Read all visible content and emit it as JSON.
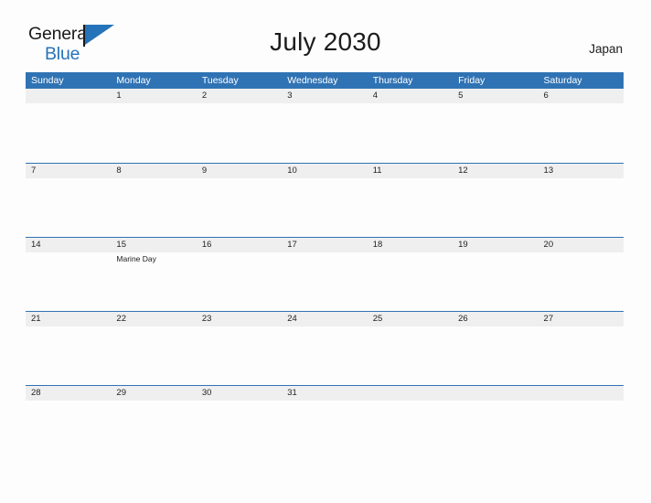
{
  "brand": {
    "line1": "General",
    "line2": "Blue",
    "flag_icon": "blue-triangle-flag-icon",
    "accent_color": "#2573b8"
  },
  "header": {
    "title": "July 2030",
    "locale": "Japan"
  },
  "calendar": {
    "month": "July",
    "year": "2030",
    "header_bg_color": "#3073b4",
    "band_bg_color": "#efefef",
    "weekdays": [
      {
        "label": "Sunday"
      },
      {
        "label": "Monday"
      },
      {
        "label": "Tuesday"
      },
      {
        "label": "Wednesday"
      },
      {
        "label": "Thursday"
      },
      {
        "label": "Friday"
      },
      {
        "label": "Saturday"
      }
    ],
    "weeks": [
      [
        {
          "day": ""
        },
        {
          "day": "1"
        },
        {
          "day": "2"
        },
        {
          "day": "3"
        },
        {
          "day": "4"
        },
        {
          "day": "5"
        },
        {
          "day": "6"
        }
      ],
      [
        {
          "day": "7"
        },
        {
          "day": "8"
        },
        {
          "day": "9"
        },
        {
          "day": "10"
        },
        {
          "day": "11"
        },
        {
          "day": "12"
        },
        {
          "day": "13"
        }
      ],
      [
        {
          "day": "14"
        },
        {
          "day": "15",
          "event": "Marine Day"
        },
        {
          "day": "16"
        },
        {
          "day": "17"
        },
        {
          "day": "18"
        },
        {
          "day": "19"
        },
        {
          "day": "20"
        }
      ],
      [
        {
          "day": "21"
        },
        {
          "day": "22"
        },
        {
          "day": "23"
        },
        {
          "day": "24"
        },
        {
          "day": "25"
        },
        {
          "day": "26"
        },
        {
          "day": "27"
        }
      ],
      [
        {
          "day": "28"
        },
        {
          "day": "29"
        },
        {
          "day": "30"
        },
        {
          "day": "31"
        },
        {
          "day": ""
        },
        {
          "day": ""
        },
        {
          "day": ""
        }
      ]
    ]
  }
}
